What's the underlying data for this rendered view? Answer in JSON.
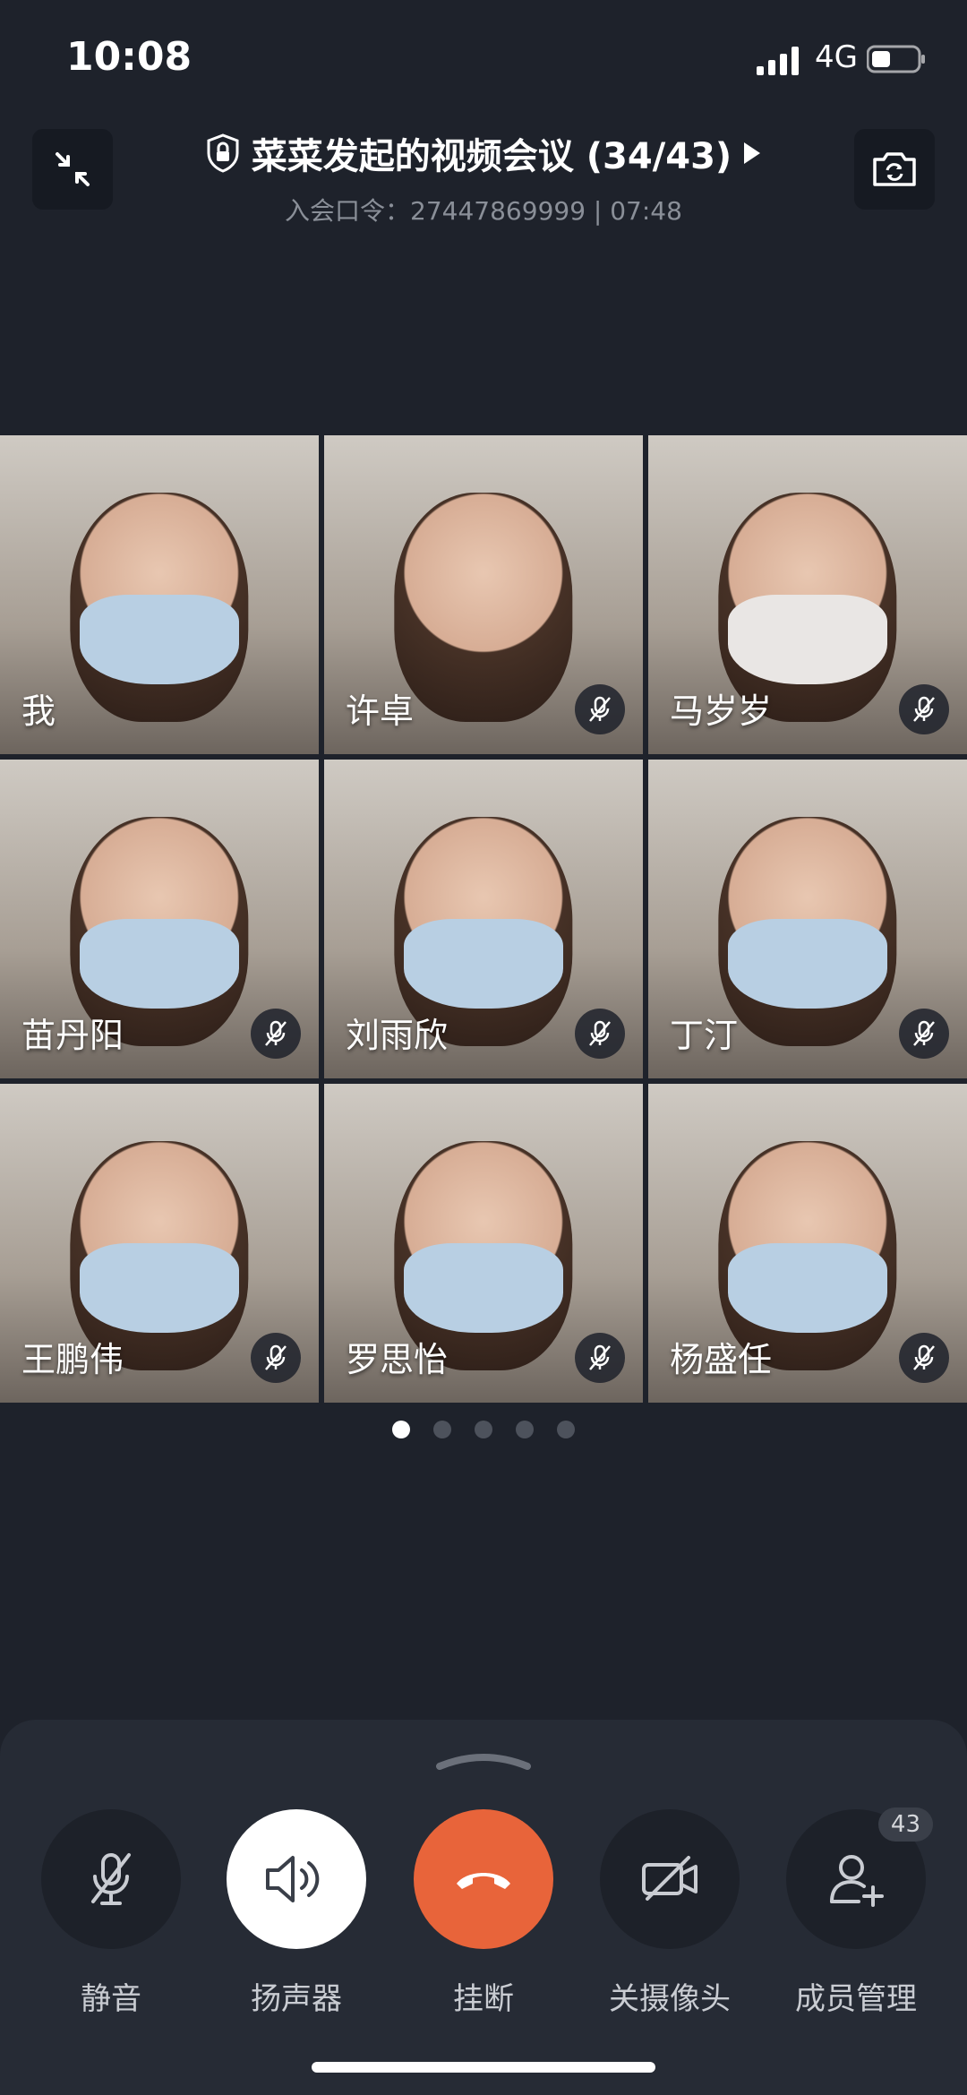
{
  "status_bar": {
    "time": "10:08",
    "network": "4G"
  },
  "header": {
    "title": "菜菜发起的视频会议 (34/43)",
    "subtitle": "入会口令：27447869999 | 07:48"
  },
  "participants": [
    {
      "name": "我",
      "muted": false
    },
    {
      "name": "许卓",
      "muted": true
    },
    {
      "name": "马岁岁",
      "muted": true
    },
    {
      "name": "苗丹阳",
      "muted": true
    },
    {
      "name": "刘雨欣",
      "muted": true
    },
    {
      "name": "丁汀",
      "muted": true
    },
    {
      "name": "王鹏伟",
      "muted": true
    },
    {
      "name": "罗思怡",
      "muted": true
    },
    {
      "name": "杨盛任",
      "muted": true
    }
  ],
  "pager": {
    "pages": 5,
    "active": 1
  },
  "controls": {
    "mute": "静音",
    "speaker": "扬声器",
    "hangup": "挂断",
    "camera_off": "关摄像头",
    "members": "成员管理",
    "members_count": "43"
  },
  "colors": {
    "background": "#1e222b",
    "hangup": "#e8643a",
    "panel": "#262b35"
  }
}
